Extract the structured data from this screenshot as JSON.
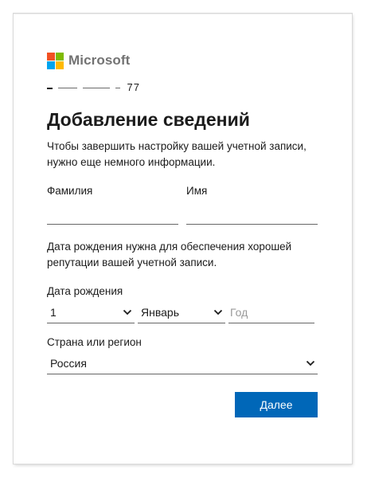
{
  "brand": {
    "name": "Microsoft",
    "logo_colors": [
      "#f25022",
      "#7fba00",
      "#00a4ef",
      "#ffb900"
    ]
  },
  "account": {
    "identity": "t̶ ̶a̶ ̶r̶ ̶ ̶..77"
  },
  "page": {
    "title": "Добавление сведений",
    "intro": "Чтобы завершить настройку вашей учетной записи, нужно еще немного информации."
  },
  "form": {
    "last_name_label": "Фамилия",
    "last_name_value": "",
    "first_name_label": "Имя",
    "first_name_value": "",
    "birth_note": "Дата рождения нужна для обеспечения хорошей репутации вашей учетной записи.",
    "dob_label": "Дата рождения",
    "day_value": "1",
    "month_value": "Январь",
    "year_placeholder": "Год",
    "country_label": "Страна или регион",
    "country_value": "Россия",
    "next_button": "Далее"
  },
  "colors": {
    "primary_button": "#0067b8",
    "text": "#1b1b1b",
    "logo_text": "#737373",
    "input_border": "#666666"
  },
  "icons": {
    "dropdown": "chevron-down-icon"
  }
}
